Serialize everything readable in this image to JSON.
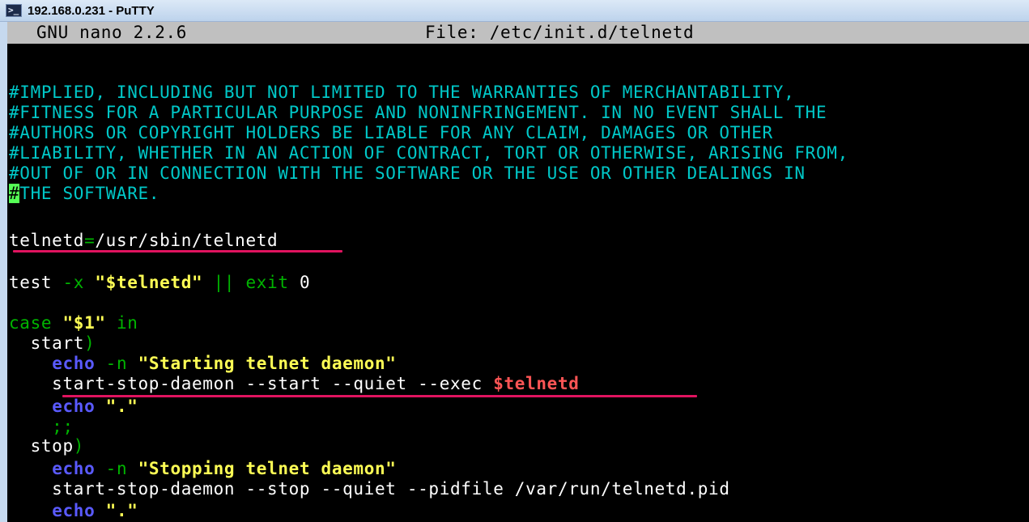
{
  "window": {
    "title": "192.168.0.231 - PuTTY",
    "icon": "putty-terminal-icon"
  },
  "nano": {
    "version_label": "GNU nano 2.2.6",
    "file_label": "File: /etc/init.d/telnetd"
  },
  "comment_lines": [
    "#IMPLIED, INCLUDING BUT NOT LIMITED TO THE WARRANTIES OF MERCHANTABILITY,",
    "#FITNESS FOR A PARTICULAR PURPOSE AND NONINFRINGEMENT. IN NO EVENT SHALL THE",
    "#AUTHORS OR COPYRIGHT HOLDERS BE LIABLE FOR ANY CLAIM, DAMAGES OR OTHER",
    "#LIABILITY, WHETHER IN AN ACTION OF CONTRACT, TORT OR OTHERWISE, ARISING FROM,",
    "#OUT OF OR IN CONNECTION WITH THE SOFTWARE OR THE USE OR OTHER DEALINGS IN"
  ],
  "last_comment": {
    "cursor_char": "#",
    "rest": "THE SOFTWARE."
  },
  "code": {
    "assign_name": "telnetd",
    "assign_eq": "=",
    "assign_value": "/usr/sbin/telnetd",
    "test_kw": "test",
    "test_flag": " -x ",
    "test_arg": "\"$telnetd\"",
    "test_or": " || ",
    "test_exit": "exit",
    "test_code": " 0",
    "case_kw": "case",
    "case_arg": "\"$1\"",
    "case_in": " in",
    "start_label": "  start",
    "paren": ")",
    "start_echo_indent": "    ",
    "echo_kw": "echo",
    "echo_n": " -n ",
    "start_msg": "\"Starting telnet daemon\"",
    "start_cmd": "    start-stop-daemon --start --quiet --exec ",
    "start_var": "$telnetd",
    "dot_msg": "\".\"",
    "dsemi": "    ;;",
    "stop_label": "  stop",
    "stop_msg": "\"Stopping telnet daemon\"",
    "stop_cmd": "    start-stop-daemon --stop --quiet --pidfile /var/run/telnetd.pid"
  },
  "colors": {
    "comment": "#00c8c8",
    "keyword": "#00b400",
    "string": "#ffff55",
    "builtin": "#5a5aff",
    "variable": "#ff5555",
    "annotation_underline": "#e0135f"
  }
}
